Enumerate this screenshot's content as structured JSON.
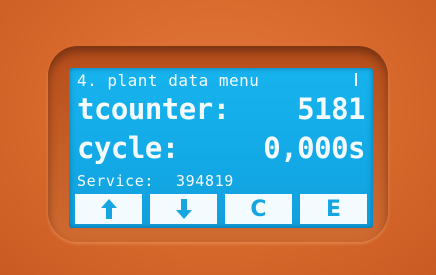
{
  "display": {
    "menu_title": "4. plant data menu",
    "tcounter": {
      "label": "tcounter:",
      "value": "5181"
    },
    "cycle": {
      "label": "cycle:",
      "value": "0,000s"
    },
    "service": {
      "label": "Service:",
      "value": "394819"
    }
  },
  "softkeys": [
    {
      "icon": "arrow-up-icon"
    },
    {
      "icon": "arrow-down-icon"
    },
    {
      "label": "C"
    },
    {
      "label": "E"
    }
  ],
  "colors": {
    "housing": "#d8692c",
    "screen": "#14ace9",
    "text": "#f4fbff"
  }
}
